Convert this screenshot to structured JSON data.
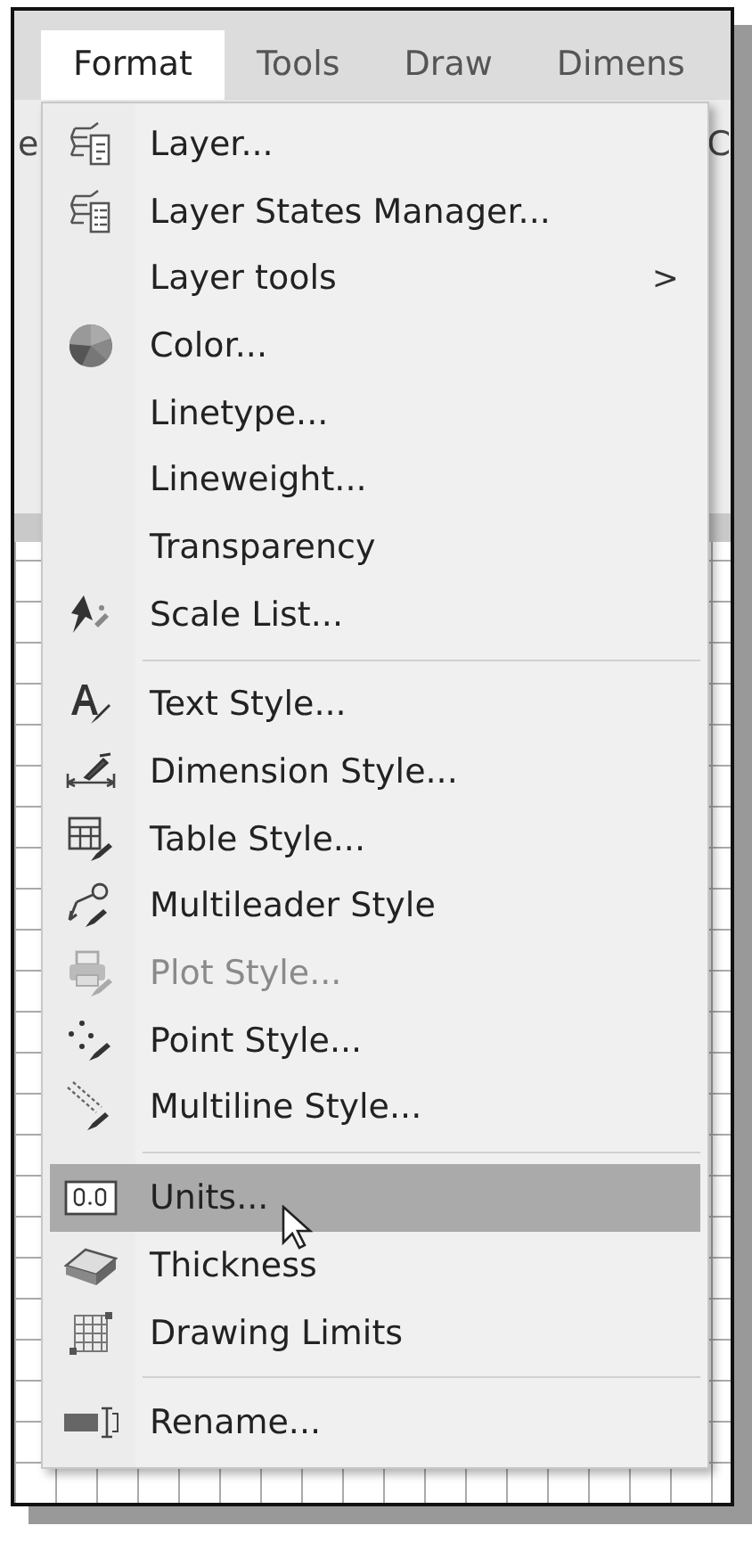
{
  "menubar": [
    {
      "label": "Format",
      "selected": true
    },
    {
      "label": "Tools",
      "selected": false
    },
    {
      "label": "Draw",
      "selected": false
    },
    {
      "label": "Dimens",
      "selected": false
    }
  ],
  "background_fragments": [
    "e",
    "C"
  ],
  "menu": [
    {
      "kind": "item",
      "label": "Layer...",
      "disabled": false,
      "selected": false
    },
    {
      "kind": "item",
      "label": "Layer States Manager...",
      "disabled": false,
      "selected": false
    },
    {
      "kind": "submenu",
      "label": "Layer tools",
      "arrow": ">",
      "disabled": false,
      "selected": false
    },
    {
      "kind": "item",
      "label": "Color...",
      "disabled": false,
      "selected": false
    },
    {
      "kind": "item",
      "label": "Linetype...",
      "disabled": false,
      "selected": false
    },
    {
      "kind": "item",
      "label": "Lineweight...",
      "disabled": false,
      "selected": false
    },
    {
      "kind": "item",
      "label": "Transparency",
      "disabled": false,
      "selected": false
    },
    {
      "kind": "item",
      "label": "Scale List...",
      "disabled": false,
      "selected": false
    },
    {
      "kind": "separator"
    },
    {
      "kind": "item",
      "label": "Text Style...",
      "disabled": false,
      "selected": false
    },
    {
      "kind": "item",
      "label": "Dimension Style...",
      "disabled": false,
      "selected": false
    },
    {
      "kind": "item",
      "label": "Table Style...",
      "disabled": false,
      "selected": false
    },
    {
      "kind": "item",
      "label": "Multileader Style",
      "disabled": false,
      "selected": false
    },
    {
      "kind": "item",
      "label": "Plot Style...",
      "disabled": true,
      "selected": false
    },
    {
      "kind": "item",
      "label": "Point Style...",
      "disabled": false,
      "selected": false
    },
    {
      "kind": "item",
      "label": "Multiline Style...",
      "disabled": false,
      "selected": false
    },
    {
      "kind": "separator"
    },
    {
      "kind": "item",
      "label": "Units...",
      "disabled": false,
      "selected": true
    },
    {
      "kind": "item",
      "label": "Thickness",
      "disabled": false,
      "selected": false
    },
    {
      "kind": "item",
      "label": "Drawing Limits",
      "disabled": false,
      "selected": false
    },
    {
      "kind": "separator"
    },
    {
      "kind": "item",
      "label": "Rename...",
      "disabled": false,
      "selected": false
    }
  ]
}
